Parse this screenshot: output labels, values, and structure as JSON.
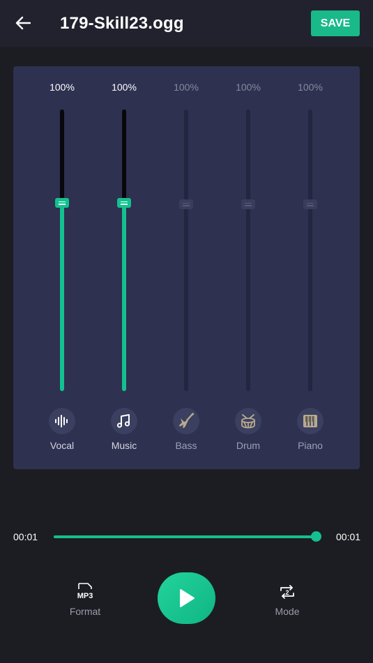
{
  "header": {
    "title": "179-Skill23.ogg",
    "save_label": "SAVE",
    "back_icon": "arrow-left-icon"
  },
  "mixer": {
    "channels": [
      {
        "label": "Vocal",
        "percent": "100%",
        "level": 0.67,
        "active": true,
        "icon": "waveform-icon"
      },
      {
        "label": "Music",
        "percent": "100%",
        "level": 0.67,
        "active": true,
        "icon": "music-note-icon"
      },
      {
        "label": "Bass",
        "percent": "100%",
        "level": 0.67,
        "active": false,
        "icon": "guitar-icon"
      },
      {
        "label": "Drum",
        "percent": "100%",
        "level": 0.67,
        "active": false,
        "icon": "drum-icon"
      },
      {
        "label": "Piano",
        "percent": "100%",
        "level": 0.67,
        "active": false,
        "icon": "piano-keys-icon"
      }
    ]
  },
  "player": {
    "current_time": "00:01",
    "total_time": "00:01",
    "progress": 1.0
  },
  "controls": {
    "format_label": "Format",
    "format_badge": "MP3",
    "mode_label": "Mode",
    "mode_badge": "2"
  },
  "colors": {
    "accent": "#14c08f",
    "background": "#1c1d22",
    "panel": "#2e3150",
    "topbar": "#22222e"
  }
}
